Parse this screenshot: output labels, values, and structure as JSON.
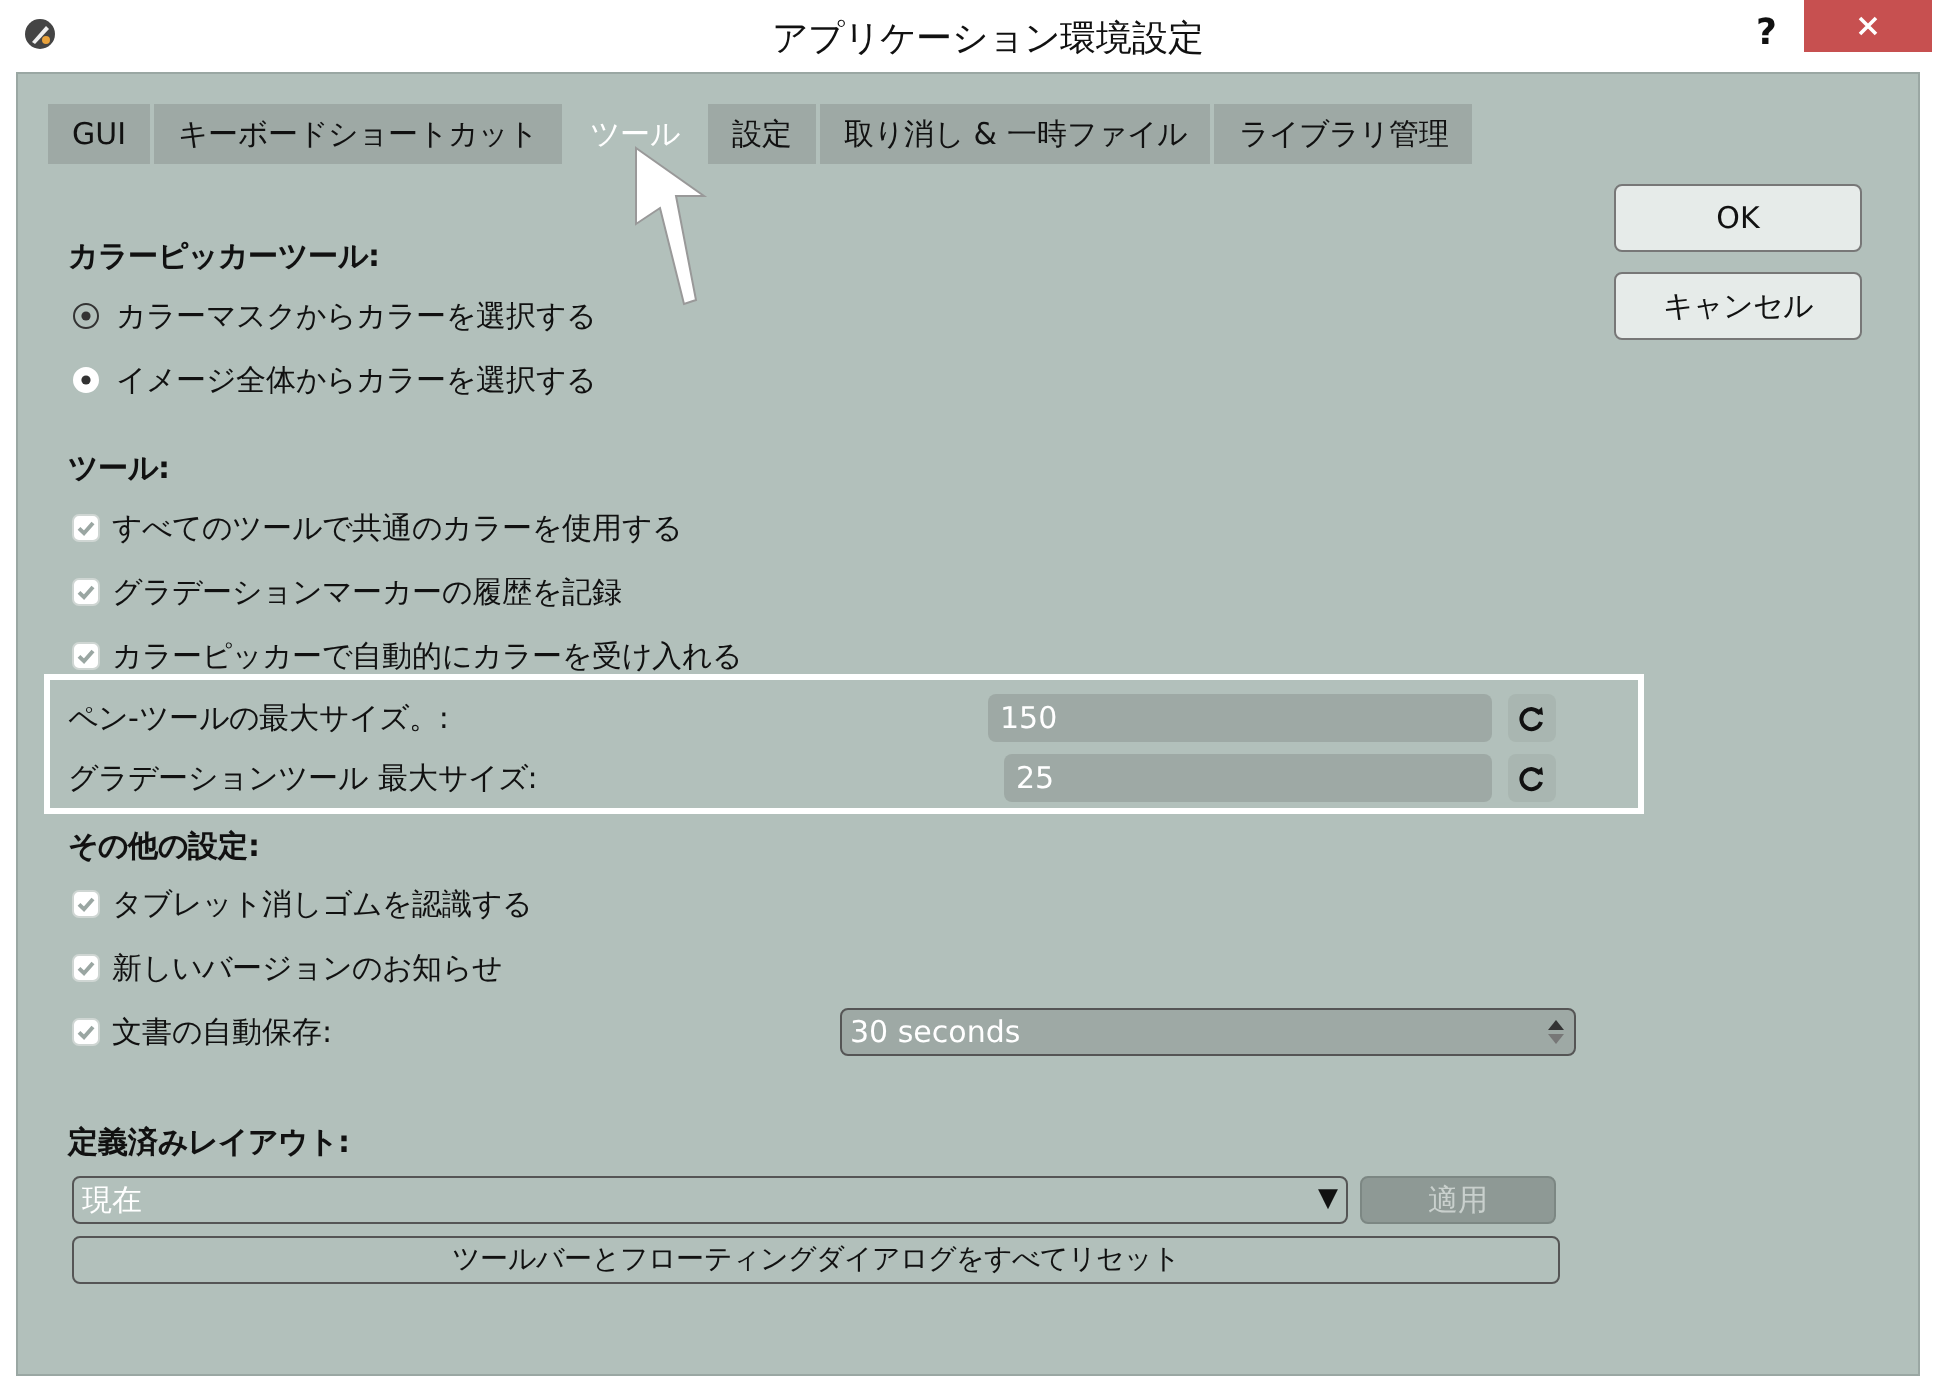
{
  "window": {
    "title": "アプリケーション環境設定",
    "help": "?"
  },
  "tabs": [
    {
      "label": "GUI",
      "selected": false
    },
    {
      "label": "キーボードショートカット",
      "selected": false
    },
    {
      "label": "ツール",
      "selected": true
    },
    {
      "label": "設定",
      "selected": false
    },
    {
      "label": "取り消し & 一時ファイル",
      "selected": false
    },
    {
      "label": "ライブラリ管理",
      "selected": false
    }
  ],
  "color_picker": {
    "heading": "カラーピッカーツール:",
    "options": [
      {
        "label": "カラーマスクからカラーを選択する",
        "selected": false
      },
      {
        "label": "イメージ全体からカラーを選択する",
        "selected": true
      }
    ]
  },
  "tools": {
    "heading": "ツール:",
    "options": [
      {
        "label": "すべてのツールで共通のカラーを使用する",
        "checked": true
      },
      {
        "label": "グラデーションマーカーの履歴を記録",
        "checked": true
      },
      {
        "label": "カラーピッカーで自動的にカラーを受け入れる",
        "checked": true
      }
    ],
    "sizes": [
      {
        "label": "ペン-ツールの最大サイズ。:",
        "value": "150"
      },
      {
        "label": "グラデーションツール 最大サイズ:",
        "value": "25"
      }
    ]
  },
  "other": {
    "heading": "その他の設定:",
    "options": [
      {
        "label": "タブレット消しゴムを認識する",
        "checked": true
      },
      {
        "label": "新しいバージョンのお知らせ",
        "checked": true
      },
      {
        "label": "文書の自動保存:",
        "checked": true
      }
    ],
    "autosave_value": "30 seconds"
  },
  "layout": {
    "heading": "定義済みレイアウト:",
    "value": "現在",
    "dropdown_arrow": "▼",
    "apply": "適用",
    "apply_disabled": true,
    "reset": "ツールバーとフローティングダイアログをすべてリセット"
  },
  "buttons": [
    "OK",
    "キャンセル"
  ]
}
